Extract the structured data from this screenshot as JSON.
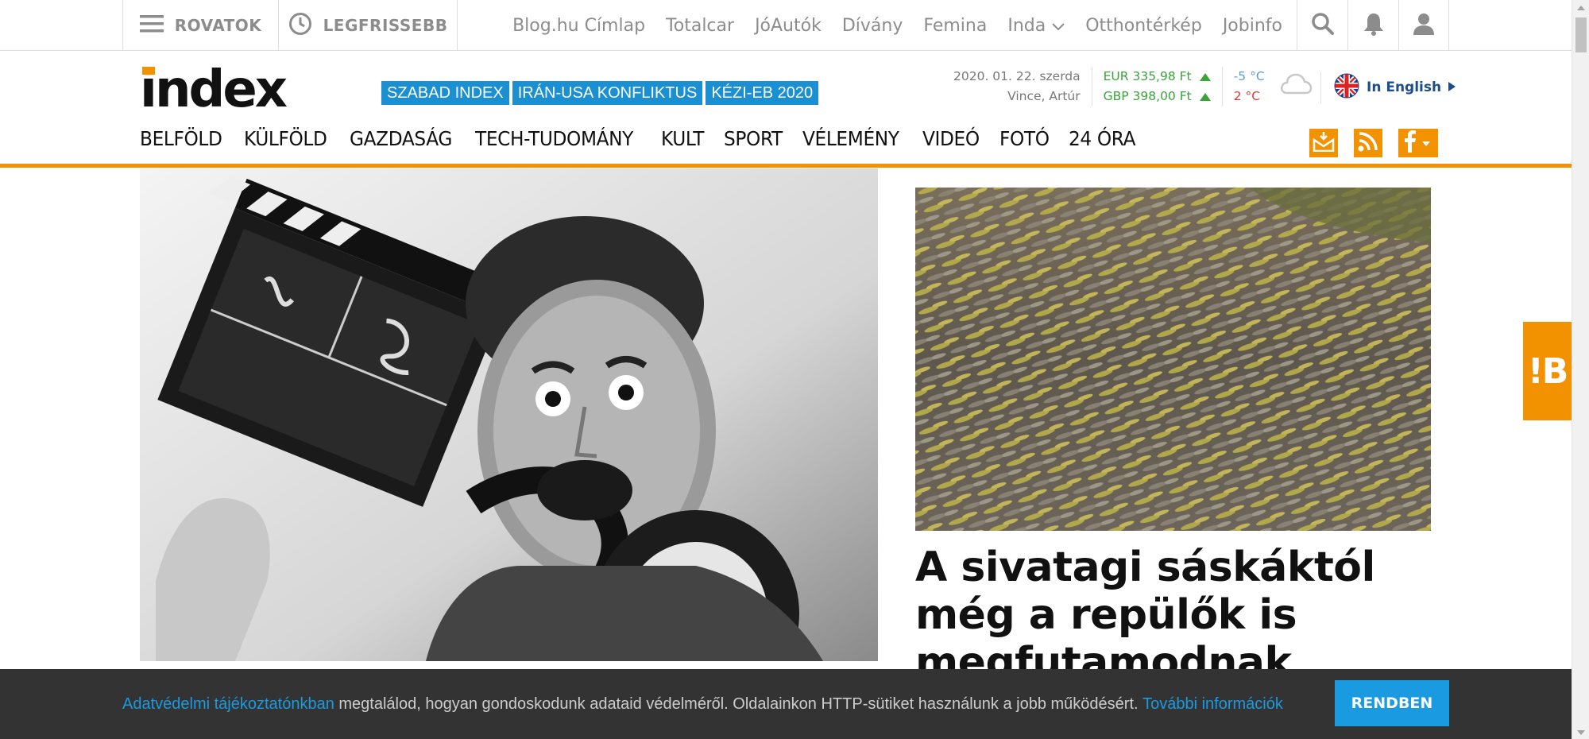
{
  "topbar": {
    "rovatok_label": "ROVATOK",
    "legfrissebb_label": "LEGFRISSEBB",
    "links": [
      {
        "label": "Blog.hu Címlap"
      },
      {
        "label": "Totalcar"
      },
      {
        "label": "JóAutók"
      },
      {
        "label": "Dívány"
      },
      {
        "label": "Femina"
      },
      {
        "label": "Inda"
      },
      {
        "label": "Otthontérkép"
      },
      {
        "label": "Jobinfo"
      }
    ],
    "icons": [
      "search-icon",
      "bell-icon",
      "user-icon"
    ]
  },
  "header": {
    "logo_text": "index",
    "tags": [
      "SZABAD INDEX",
      "IRÁN-USA KONFLIKTUS",
      "KÉZI-EB 2020"
    ],
    "date": "2020. 01. 22. szerda",
    "namedays": "Vince, Artúr",
    "eur": "EUR 335,98 Ft",
    "gbp": "GBP 398,00 Ft",
    "temp_min": "-5 °C",
    "temp_max": "2 °C",
    "english_label": "In English"
  },
  "nav": {
    "items": [
      "BELFÖLD",
      "KÜLFÖLD",
      "GAZDASÁG",
      "TECH-TUDOMÁNY",
      "KULT",
      "SPORT",
      "VÉLEMÉNY",
      "VIDEÓ",
      "FOTÓ",
      "24 ÓRA"
    ],
    "icons": [
      "newsletter-icon",
      "rss-icon",
      "facebook-icon"
    ]
  },
  "main": {
    "headline": "A sivatagi sáskáktól még a repülők is megfutamodnak"
  },
  "side_tab": {
    "label": "!B"
  },
  "cookie": {
    "link1": "Adatvédelmi tájékoztatónkban",
    "text": " megtalálod, hogyan gondoskodunk adataid védelméről. Oldalainkon HTTP-sütiket használunk a jobb működésért. ",
    "link2": "További információk",
    "button": "RENDBEN"
  },
  "colors": {
    "accent": "#f39200",
    "tag_blue": "#1a8fd1",
    "up_green": "#3aa33a",
    "temp_red": "#e03a3a",
    "temp_blue": "#5b9bd5"
  }
}
